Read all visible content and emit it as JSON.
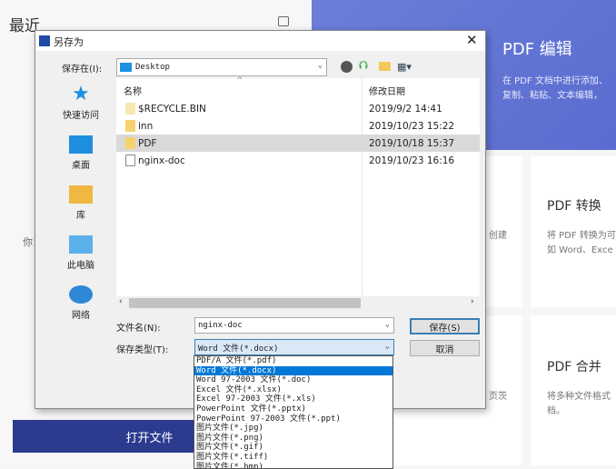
{
  "background": {
    "recent_title": "最近",
    "hint_text": "你",
    "open_file_button": "打开文件",
    "hero": {
      "title": "PDF 编辑",
      "desc_line1": "在 PDF 文档中进行添加、",
      "desc_line2": "复制、粘贴、文本编辑，"
    },
    "cards": [
      {
        "partial_text": "创建"
      },
      {
        "title": "PDF 转换",
        "desc_line1": "将 PDF 转换为可",
        "desc_line2": "如 Word、Exce"
      },
      {
        "partial_text": "页茨"
      },
      {
        "title": "PDF 合并",
        "desc_line1": "将多种文件格式",
        "desc_line2": "档。"
      }
    ]
  },
  "dialog": {
    "title": "另存为",
    "save_in_label": "保存在(I):",
    "save_in_value": "Desktop",
    "sidebar": [
      {
        "label": "快速访问",
        "icon": "star-icon"
      },
      {
        "label": "桌面",
        "icon": "desktop-icon"
      },
      {
        "label": "库",
        "icon": "library-icon"
      },
      {
        "label": "此电脑",
        "icon": "computer-icon"
      },
      {
        "label": "网络",
        "icon": "network-icon"
      }
    ],
    "columns": {
      "name": "名称",
      "modified": "修改日期"
    },
    "files": [
      {
        "name": "$RECYCLE.BIN",
        "date": "2019/9/2 14:41"
      },
      {
        "name": "inn",
        "date": "2019/10/23 15:22"
      },
      {
        "name": "PDF",
        "date": "2019/10/18 15:37"
      },
      {
        "name": "nginx-doc",
        "date": "2019/10/23 16:16"
      }
    ],
    "filename_label": "文件名(N):",
    "filename_value": "nginx-doc",
    "filetype_label": "保存类型(T):",
    "filetype_value": "Word 文件(*.docx)",
    "save_button": "保存(S)",
    "cancel_button": "取消",
    "filetype_options": [
      "PDF/A 文件(*.pdf)",
      "Word 文件(*.docx)",
      "Word 97-2003 文件(*.doc)",
      "Excel 文件(*.xlsx)",
      "Excel 97-2003 文件(*.xls)",
      "PowerPoint 文件(*.pptx)",
      "PowerPoint 97-2003 文件(*.ppt)",
      "图片文件(*.jpg)",
      "图片文件(*.png)",
      "图片文件(*.gif)",
      "图片文件(*.tiff)",
      "图片文件(*.bmp)"
    ],
    "selected_option_index": 1
  }
}
